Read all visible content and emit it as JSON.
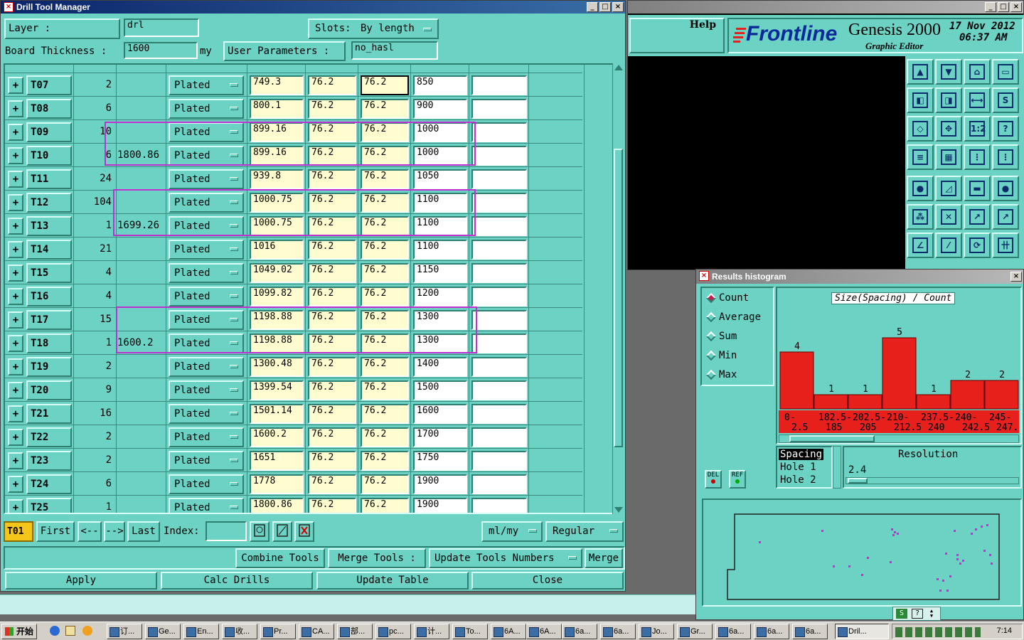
{
  "drill_window": {
    "title": "Drill Tool Manager",
    "layer_label": "Layer :",
    "layer_value": "drl",
    "slots_label": "Slots:",
    "slots_value": "By length",
    "thickness_label": "Board Thickness :",
    "thickness_value": "1600",
    "thickness_unit": "my",
    "user_params_label": "User Parameters :",
    "user_params_value": "no_hasl",
    "rows": [
      {
        "tool": "T07",
        "count": "2",
        "slot": "",
        "type": "Plated",
        "f1": "749.3",
        "f2": "76.2",
        "f3": "76.2",
        "f4": "850",
        "f5": ""
      },
      {
        "tool": "T08",
        "count": "6",
        "slot": "",
        "type": "Plated",
        "f1": "800.1",
        "f2": "76.2",
        "f3": "76.2",
        "f4": "900",
        "f5": ""
      },
      {
        "tool": "T09",
        "count": "10",
        "slot": "",
        "type": "Plated",
        "f1": "899.16",
        "f2": "76.2",
        "f3": "76.2",
        "f4": "1000",
        "f5": ""
      },
      {
        "tool": "T10",
        "count": "6",
        "slot": "1800.86",
        "type": "Plated",
        "f1": "899.16",
        "f2": "76.2",
        "f3": "76.2",
        "f4": "1000",
        "f5": ""
      },
      {
        "tool": "T11",
        "count": "24",
        "slot": "",
        "type": "Plated",
        "f1": "939.8",
        "f2": "76.2",
        "f3": "76.2",
        "f4": "1050",
        "f5": ""
      },
      {
        "tool": "T12",
        "count": "104",
        "slot": "",
        "type": "Plated",
        "f1": "1000.75",
        "f2": "76.2",
        "f3": "76.2",
        "f4": "1100",
        "f5": ""
      },
      {
        "tool": "T13",
        "count": "1",
        "slot": "1699.26",
        "type": "Plated",
        "f1": "1000.75",
        "f2": "76.2",
        "f3": "76.2",
        "f4": "1100",
        "f5": ""
      },
      {
        "tool": "T14",
        "count": "21",
        "slot": "",
        "type": "Plated",
        "f1": "1016",
        "f2": "76.2",
        "f3": "76.2",
        "f4": "1100",
        "f5": ""
      },
      {
        "tool": "T15",
        "count": "4",
        "slot": "",
        "type": "Plated",
        "f1": "1049.02",
        "f2": "76.2",
        "f3": "76.2",
        "f4": "1150",
        "f5": ""
      },
      {
        "tool": "T16",
        "count": "4",
        "slot": "",
        "type": "Plated",
        "f1": "1099.82",
        "f2": "76.2",
        "f3": "76.2",
        "f4": "1200",
        "f5": ""
      },
      {
        "tool": "T17",
        "count": "15",
        "slot": "",
        "type": "Plated",
        "f1": "1198.88",
        "f2": "76.2",
        "f3": "76.2",
        "f4": "1300",
        "f5": ""
      },
      {
        "tool": "T18",
        "count": "1",
        "slot": "1600.2",
        "type": "Plated",
        "f1": "1198.88",
        "f2": "76.2",
        "f3": "76.2",
        "f4": "1300",
        "f5": ""
      },
      {
        "tool": "T19",
        "count": "2",
        "slot": "",
        "type": "Plated",
        "f1": "1300.48",
        "f2": "76.2",
        "f3": "76.2",
        "f4": "1400",
        "f5": ""
      },
      {
        "tool": "T20",
        "count": "9",
        "slot": "",
        "type": "Plated",
        "f1": "1399.54",
        "f2": "76.2",
        "f3": "76.2",
        "f4": "1500",
        "f5": ""
      },
      {
        "tool": "T21",
        "count": "16",
        "slot": "",
        "type": "Plated",
        "f1": "1501.14",
        "f2": "76.2",
        "f3": "76.2",
        "f4": "1600",
        "f5": ""
      },
      {
        "tool": "T22",
        "count": "2",
        "slot": "",
        "type": "Plated",
        "f1": "1600.2",
        "f2": "76.2",
        "f3": "76.2",
        "f4": "1700",
        "f5": ""
      },
      {
        "tool": "T23",
        "count": "2",
        "slot": "",
        "type": "Plated",
        "f1": "1651",
        "f2": "76.2",
        "f3": "76.2",
        "f4": "1750",
        "f5": ""
      },
      {
        "tool": "T24",
        "count": "6",
        "slot": "",
        "type": "Plated",
        "f1": "1778",
        "f2": "76.2",
        "f3": "76.2",
        "f4": "1900",
        "f5": ""
      },
      {
        "tool": "T25",
        "count": "1",
        "slot": "",
        "type": "Plated",
        "f1": "1800.86",
        "f2": "76.2",
        "f3": "76.2",
        "f4": "1900",
        "f5": ""
      }
    ],
    "nav": {
      "current": "T01",
      "first": "First",
      "prev": "<--",
      "next": "-->",
      "last": "Last",
      "index_label": "Index:",
      "units": "ml/my",
      "mode": "Regular"
    },
    "buttons": {
      "combine": "Combine Tools",
      "merge_tools": "Merge Tools :",
      "update_numbers": "Update Tools Numbers",
      "merge": "Merge",
      "apply": "Apply",
      "calc": "Calc Drills",
      "update_table": "Update Table",
      "close": "Close"
    }
  },
  "genesis": {
    "help": "Help",
    "brand": "Frontline",
    "product": "Genesis 2000",
    "subtitle": "Graphic Editor",
    "date": "17 Nov 2012",
    "time": "06:37 AM"
  },
  "histogram": {
    "title": "Results histogram",
    "options": [
      "Count",
      "Average",
      "Sum",
      "Min",
      "Max"
    ],
    "selected": "Count",
    "header": "Size(Spacing) / Count",
    "del": "DEL",
    "ref": "REF",
    "list": [
      "Spacing",
      "Hole 1",
      "Hole 2"
    ],
    "resolution_label": "Resolution",
    "resolution_value": "2.4",
    "chart_data": {
      "type": "bar",
      "categories": [
        "0-2.5",
        "182.5-185",
        "202.5-205",
        "210-212.5",
        "237.5-240",
        "240-242.5",
        "245-247.5"
      ],
      "category_lines": [
        [
          "0-",
          "2.5"
        ],
        [
          "182.5-",
          "185"
        ],
        [
          "202.5-",
          "205"
        ],
        [
          "210-",
          "212.5"
        ],
        [
          "237.5-",
          "240"
        ],
        [
          "240-",
          "242.5"
        ],
        [
          "245-",
          "247.5"
        ]
      ],
      "values": [
        4,
        1,
        1,
        5,
        1,
        2,
        2
      ],
      "labels": [
        "4",
        "1",
        "1",
        "5",
        "1",
        "2",
        "2"
      ],
      "title": "Size(Spacing) / Count",
      "bar_color": "#e8201c"
    }
  },
  "taskbar": {
    "start": "开始",
    "items": [
      "订...",
      "Ge...",
      "En...",
      "收...",
      "Pr...",
      "CA...",
      "部...",
      "pc...",
      "计...",
      "To...",
      "6A...",
      "6A...",
      "6a...",
      "6a...",
      "Jo...",
      "Gr...",
      "6a...",
      "6a...",
      "6a...",
      "Dril..."
    ],
    "active_index": 19,
    "clock": "7:14"
  }
}
